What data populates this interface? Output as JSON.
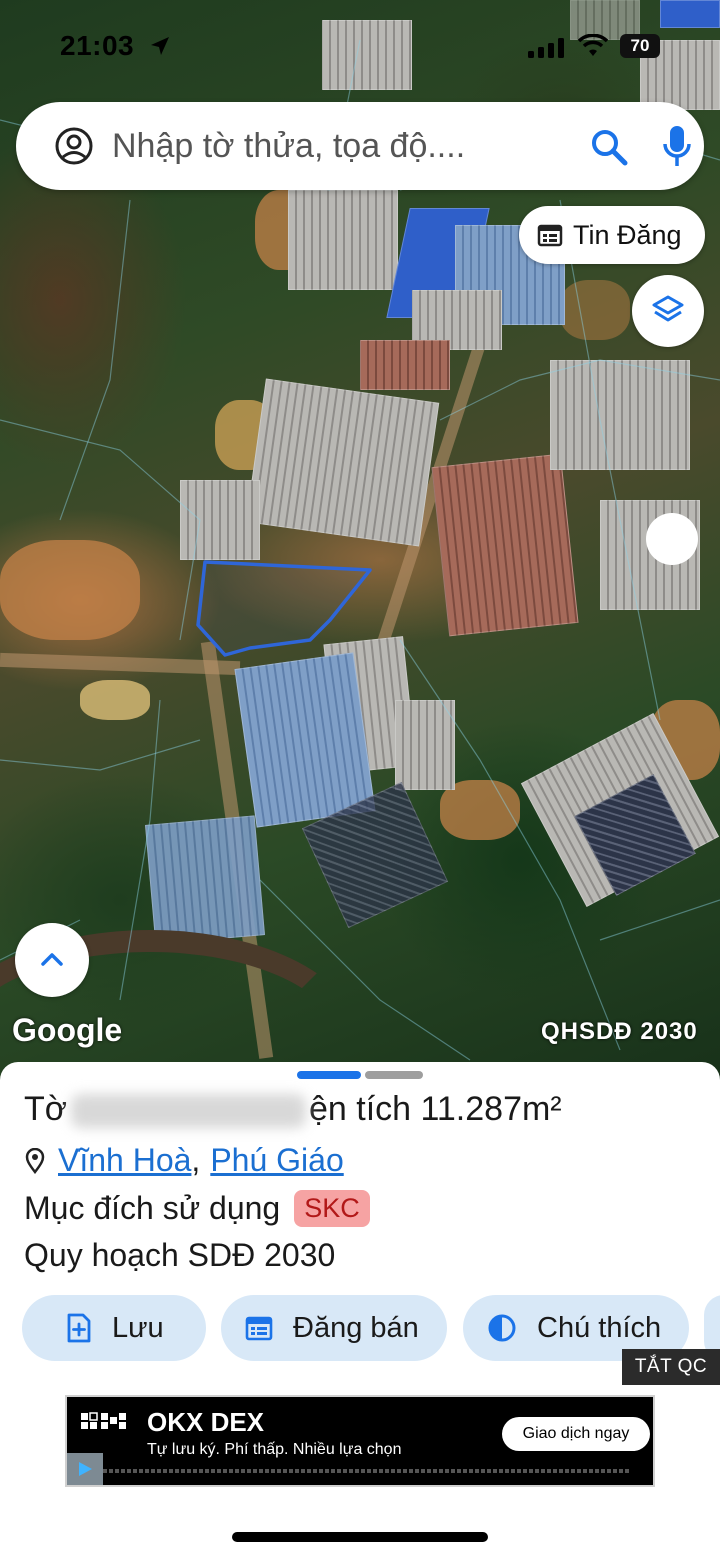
{
  "status_bar": {
    "time": "21:03",
    "battery": "70"
  },
  "search": {
    "placeholder": "Nhập tờ thửa, tọa độ...."
  },
  "map": {
    "tin_dang_label": "Tin Đăng",
    "google_label": "Google",
    "planning_label": "QHSDĐ 2030",
    "parcel_outline_color": "#2f66d8"
  },
  "sheet": {
    "title_prefix": "Tờ",
    "title_area_prefix": "ện tích",
    "area_value": "11.287m²",
    "location_commune": "Vĩnh Hoà",
    "location_separator": ",",
    "location_district": "Phú Giáo",
    "purpose_label": "Mục đích sử dụng",
    "purpose_code": "SKC",
    "planning_text": "Quy hoạch SDĐ 2030",
    "actions": {
      "save": "Lưu",
      "sell": "Đăng bán",
      "legend": "Chú thích"
    },
    "ads_off": "TẮT QC"
  },
  "ad": {
    "brand": "OKX DEX",
    "tagline": "Tự lưu ký. Phí thấp. Nhiều lựa chọn",
    "cta": "Giao dịch ngay"
  },
  "colors": {
    "accent": "#1b73e8",
    "link": "#1b6fd1",
    "badge_bg": "#f6a3a3",
    "badge_text": "#b21818",
    "action_bg": "#d8e8f7"
  }
}
